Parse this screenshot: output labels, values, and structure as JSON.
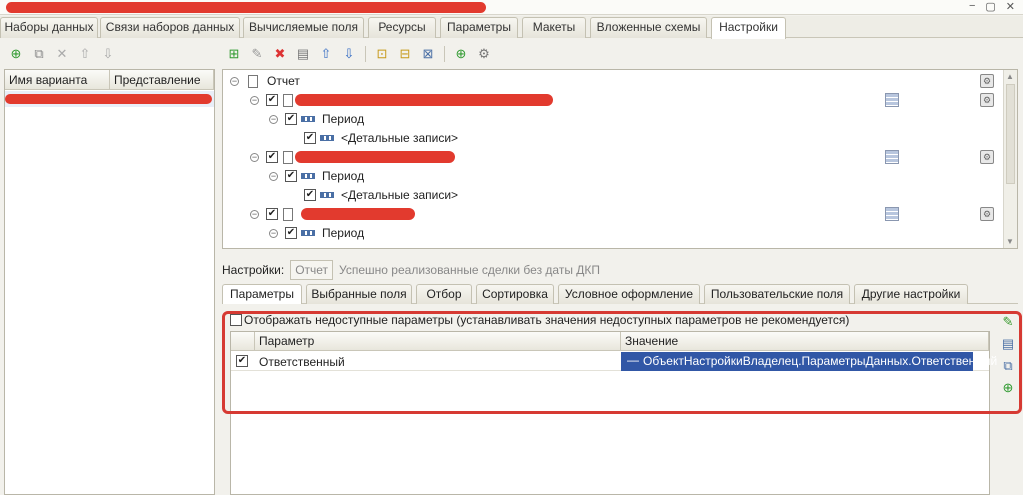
{
  "window": {
    "controls": [
      "−",
      "▢",
      "✕"
    ]
  },
  "tabs": [
    {
      "label": "Наборы данных"
    },
    {
      "label": "Связи наборов данных"
    },
    {
      "label": "Вычисляемые поля"
    },
    {
      "label": "Ресурсы"
    },
    {
      "label": "Параметры"
    },
    {
      "label": "Макеты"
    },
    {
      "label": "Вложенные схемы"
    },
    {
      "label": "Настройки",
      "active": true
    }
  ],
  "left_panel": {
    "toolbar_icons": [
      "add-icon",
      "copy-icon",
      "delete-icon",
      "move-up-icon",
      "move-down-icon"
    ],
    "columns": [
      "Имя варианта",
      "Представление"
    ]
  },
  "tree": {
    "root_label": "Отчет",
    "nodes": [
      {
        "children": [
          {
            "label": "Период",
            "child": "<Детальные записи>"
          }
        ]
      },
      {
        "children": [
          {
            "label": "Период",
            "child": "<Детальные записи>"
          }
        ]
      },
      {
        "children": [
          {
            "label": "Период",
            "child": ""
          }
        ]
      }
    ]
  },
  "settings": {
    "label": "Настройки:",
    "field_value": "Отчет",
    "description": "Успешно реализованные сделки без даты ДКП"
  },
  "subtabs": [
    {
      "label": "Параметры",
      "active": true
    },
    {
      "label": "Выбранные поля"
    },
    {
      "label": "Отбор"
    },
    {
      "label": "Сортировка"
    },
    {
      "label": "Условное оформление"
    },
    {
      "label": "Пользовательские поля"
    },
    {
      "label": "Другие настройки"
    }
  ],
  "params": {
    "show_unavailable_label": "Отображать недоступные параметры (устанавливать значения недоступных параметров не рекомендуется)",
    "columns": [
      "Параметр",
      "Значение"
    ],
    "rows": [
      {
        "checked": true,
        "name": "Ответственный",
        "value": "ОбъектНастройкиВладелец.ПараметрыДанных.Ответственный"
      }
    ]
  },
  "colors": {
    "accent_selection": "#3157a6",
    "highlight_frame": "#d63a33",
    "redaction": "#e23a2e"
  }
}
